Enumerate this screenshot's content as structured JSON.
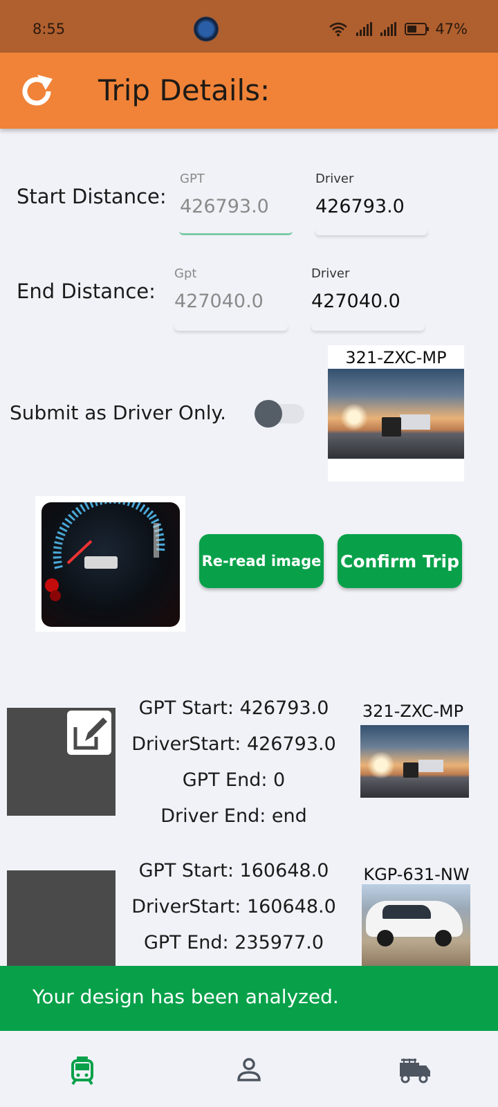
{
  "status_bar": {
    "time": "8:55",
    "battery": "47%",
    "icons": [
      "app-notification-icon",
      "wifi-icon",
      "signal-icon",
      "signal-icon",
      "battery-icon"
    ]
  },
  "app_bar": {
    "title": "Trip Details:",
    "refresh_icon": "refresh-icon",
    "background": "#f08338"
  },
  "start_distance": {
    "label": "Start Distance:",
    "gpt_label": "GPT",
    "gpt_value": "426793.0",
    "driver_label": "Driver",
    "driver_value": "426793.0"
  },
  "end_distance": {
    "label": "End Distance:",
    "gpt_label": "Gpt",
    "gpt_value": "427040.0",
    "driver_label": "Driver",
    "driver_value": "427040.0"
  },
  "driver_only": {
    "label": "Submit as Driver Only.",
    "on": false
  },
  "current_vehicle": {
    "plate": "321-ZXC-MP"
  },
  "buttons": {
    "reread": "Re-read image",
    "confirm": "Confirm Trip",
    "color": "#08a14a"
  },
  "trips": [
    {
      "gpt_start": "GPT Start: 426793.0",
      "driver_start": "DriverStart: 426793.0",
      "gpt_end": "GPT End: 0",
      "driver_end": "Driver End: end",
      "plate": "321-ZXC-MP"
    },
    {
      "gpt_start": "GPT Start: 160648.0",
      "driver_start": "DriverStart: 160648.0",
      "gpt_end": "GPT End: 235977.0",
      "plate": "KGP-631-NW"
    }
  ],
  "snackbar": {
    "message": "Your design has been analyzed."
  },
  "bottom_nav": {
    "items": [
      "tram-icon",
      "person-icon",
      "fire-truck-icon"
    ],
    "active_color": "#08a14a"
  }
}
